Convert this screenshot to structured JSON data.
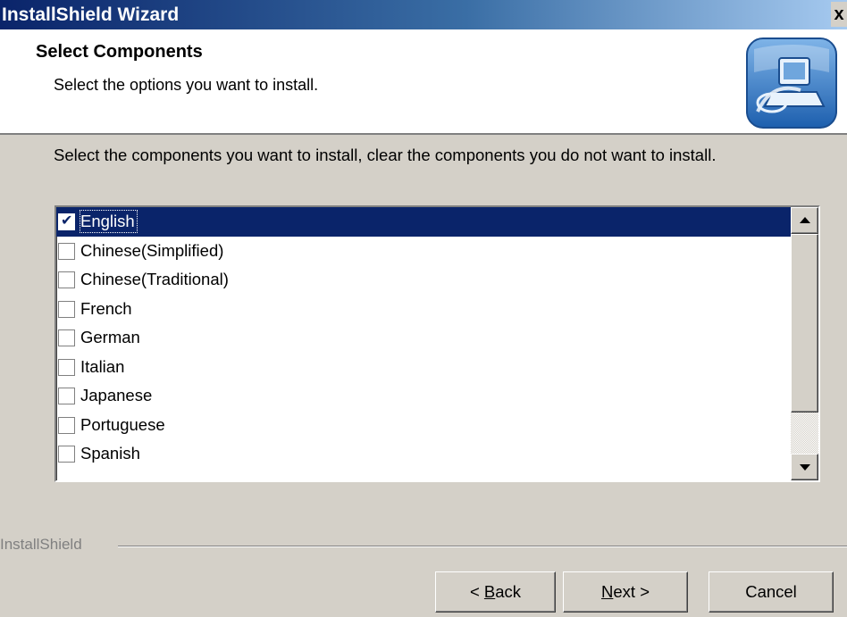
{
  "window": {
    "title": "InstallShield Wizard",
    "close_glyph": "x"
  },
  "header": {
    "title": "Select Components",
    "subtitle": "Select the options you want to install.",
    "icon": "installshield-computer-icon"
  },
  "instruction": "Select the components you want to install, clear the components you do not want to install.",
  "components": [
    {
      "label": "English",
      "checked": true,
      "selected": true
    },
    {
      "label": "Chinese(Simplified)",
      "checked": false,
      "selected": false
    },
    {
      "label": "Chinese(Traditional)",
      "checked": false,
      "selected": false
    },
    {
      "label": "French",
      "checked": false,
      "selected": false
    },
    {
      "label": "German",
      "checked": false,
      "selected": false
    },
    {
      "label": "Italian",
      "checked": false,
      "selected": false
    },
    {
      "label": "Japanese",
      "checked": false,
      "selected": false
    },
    {
      "label": "Portuguese",
      "checked": false,
      "selected": false
    },
    {
      "label": "Spanish",
      "checked": false,
      "selected": false
    }
  ],
  "footer": {
    "brand": "InstallShield",
    "back": {
      "mnemonic": "B",
      "rest": "ack",
      "arrow": "<"
    },
    "next": {
      "mnemonic": "N",
      "rest": "ext",
      "arrow": ">"
    },
    "cancel": "Cancel"
  },
  "colors": {
    "title_bar": "#0a246a",
    "selection": "#0a246a",
    "dialog_face": "#d4d0c8"
  }
}
